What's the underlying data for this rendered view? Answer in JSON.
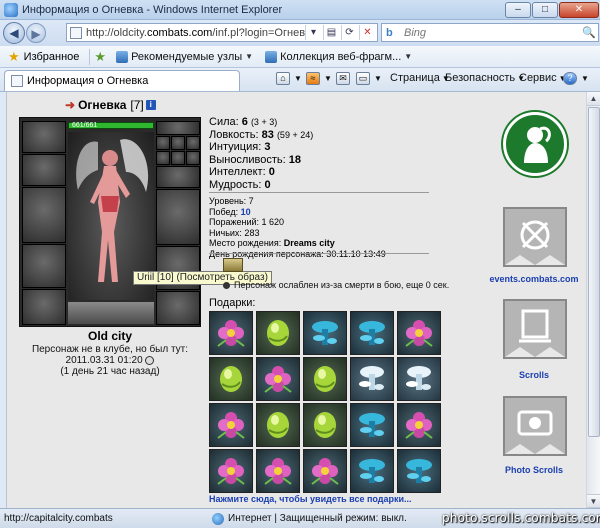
{
  "window": {
    "title": "Информация о Огневка - Windows Internet Explorer"
  },
  "address_bar": {
    "url_prefix": "http://oldcity.",
    "url_domain": "combats.com",
    "url_suffix": "/inf.pl?login=Огнева",
    "search_placeholder": "Bing"
  },
  "favorites_bar": {
    "favorites_label": "Избранное",
    "links": [
      {
        "label": "Рекомендуемые узлы"
      },
      {
        "label": "Коллекция веб-фрагм..."
      }
    ]
  },
  "tab": {
    "label": "Информация о Огневка"
  },
  "command_bar": {
    "page_label": "Страница",
    "safety_label": "Безопасность",
    "service_label": "Сервис",
    "help_label": "?"
  },
  "character": {
    "name": "Огневка",
    "level": "[7]",
    "info_badge": "i",
    "hp": "661/661",
    "tooltip": "Uriil [10] (Посмотреть образ)",
    "city": "Old city",
    "last_seen_line1": "Персонаж не в клубе, но был тут:",
    "last_seen_date": "2011.03.31 01:20",
    "last_seen_ago": "(1 день 21 час назад)"
  },
  "stats": [
    {
      "label": "Сила:",
      "value": "6",
      "extra": "(3 + 3)"
    },
    {
      "label": "Ловкость:",
      "value": "83",
      "extra": "(59 + 24)"
    },
    {
      "label": "Интуиция:",
      "value": "3",
      "extra": ""
    },
    {
      "label": "Выносливость:",
      "value": "18",
      "extra": ""
    },
    {
      "label": "Интеллект:",
      "value": "0",
      "extra": ""
    },
    {
      "label": "Мудрость:",
      "value": "0",
      "extra": ""
    }
  ],
  "details": {
    "level": "Уровень: 7",
    "wins_label": "Побед:",
    "wins_value": "10",
    "losses": "Поражений: 1 620",
    "draws": "Ничьих: 283",
    "birthplace_label": "Место рождения:",
    "birthplace_value": "Dreams city",
    "birthday": "День рождения персонажа: 30.11.10 13:49"
  },
  "status_effect": "Персонаж ослаблен из-за смерти в бою, еще 0 сек.",
  "gifts": {
    "title": "Подарки:",
    "see_all": "Нажмите сюда, чтобы увидеть все подарки...",
    "items": [
      "pink-flower",
      "green-stone",
      "blue-mushroom",
      "blue-mushroom",
      "pink-flower",
      "green-stone",
      "pink-flower",
      "green-stone",
      "white-mushroom",
      "white-mushroom",
      "pink-flower",
      "green-stone",
      "green-stone",
      "blue-mushroom",
      "pink-flower",
      "pink-flower",
      "pink-flower",
      "pink-flower",
      "blue-mushroom",
      "blue-mushroom"
    ]
  },
  "banners": [
    {
      "label": "events.combats.com",
      "icon": "events"
    },
    {
      "label": "Scrolls",
      "icon": "scrolls"
    },
    {
      "label": "Photo Scrolls",
      "icon": "photo"
    }
  ],
  "status_bar": {
    "url": "http://capitalcity.combats",
    "zone": "Интернет | Защищенный режим: выкл.",
    "watermark": "photo.scrolls.combats.com"
  },
  "colors": {
    "accent_link": "#1a3fb0",
    "hp_green": "#2fb82f",
    "emblem_green": "#1d7a2c"
  }
}
